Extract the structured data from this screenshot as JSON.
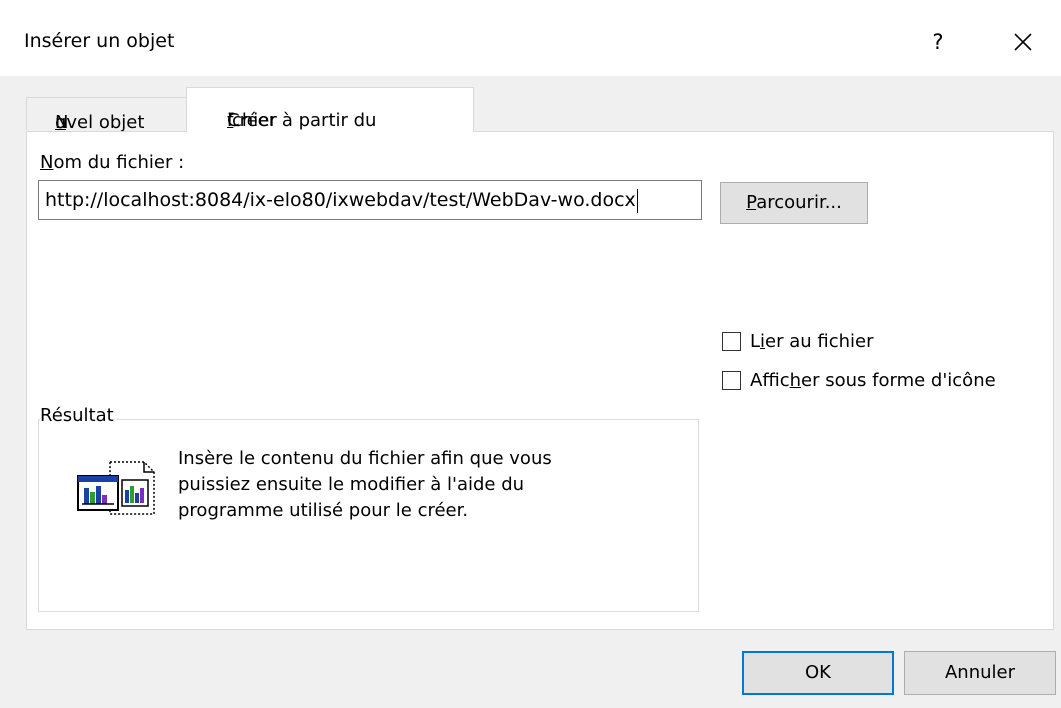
{
  "dialog": {
    "title": "Insérer un objet",
    "help_glyph": "?",
    "close_glyph": "close-icon"
  },
  "tabs": [
    {
      "label_pre": "N",
      "label_u": "o",
      "label_post": "uvel objet",
      "active": false
    },
    {
      "label_pre": "Créer à partir du ",
      "label_u": "f",
      "label_post": "ichier",
      "active": true
    }
  ],
  "filename": {
    "label_u": "N",
    "label_post": "om du fichier :",
    "value": "http://localhost:8084/ix-elo80/ixwebdav/test/WebDav-wo.docx"
  },
  "browse": {
    "label_u": "P",
    "label_post": "arcourir..."
  },
  "options": [
    {
      "label_pre": "L",
      "label_u": "i",
      "label_post": "er au fichier",
      "checked": false
    },
    {
      "label_pre": "Affic",
      "label_u": "h",
      "label_post": "er sous forme d'icône",
      "checked": false
    }
  ],
  "result": {
    "legend": "Résultat",
    "icon": "embedded-document-icon",
    "lines": [
      "Insère le contenu du fichier afin que vous",
      "puissiez ensuite le modifier à l'aide du",
      "programme utilisé pour le créer."
    ]
  },
  "buttons": {
    "ok": "OK",
    "cancel": "Annuler"
  },
  "colors": {
    "accent": "#0078d7",
    "dialog_bg": "#f0f0f0",
    "button_bg": "#e1e1e1"
  }
}
